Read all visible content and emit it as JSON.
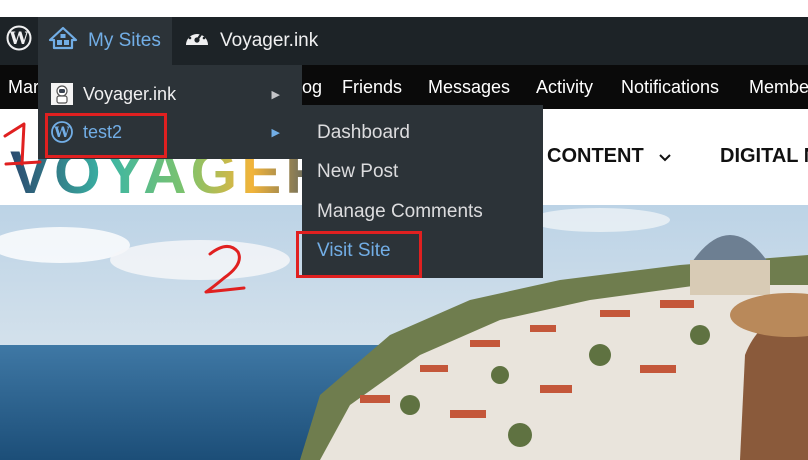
{
  "adminbar": {
    "wp_logo_icon": "wordpress-logo-icon",
    "my_sites_label": "My Sites",
    "my_sites_icon": "network-sites-icon",
    "site_label": "Voyager.ink",
    "site_icon": "dashboard-gauge-icon"
  },
  "subnav": {
    "items": [
      "Mar",
      "og",
      "Friends",
      "Messages",
      "Activity",
      "Notifications",
      "Membe"
    ]
  },
  "header": {
    "logo_text": "VOYAGER",
    "nav": [
      {
        "label": "CONTENT",
        "icon": "chevron-down-icon"
      },
      {
        "label": "DIGITAL N"
      }
    ]
  },
  "my_sites_menu": {
    "items": [
      {
        "label": "Voyager.ink",
        "icon": "astronaut-avatar-icon",
        "arrow": "▶"
      },
      {
        "label": "test2",
        "icon": "wordpress-logo-icon",
        "arrow": "▶"
      }
    ]
  },
  "site_submenu": {
    "items": [
      "Dashboard",
      "New Post",
      "Manage Comments",
      "Visit Site"
    ]
  },
  "annotations": {
    "step1": "1",
    "step2": "2",
    "color": "#e02020"
  },
  "colors": {
    "adminbar_bg": "#1d2327",
    "menu_bg": "#2c3338",
    "link_blue": "#72aee6",
    "logo_gradient": [
      "#2b4a6f",
      "#3bb6a5",
      "#7fc36b",
      "#f2b43a",
      "#2b4a6f"
    ]
  }
}
